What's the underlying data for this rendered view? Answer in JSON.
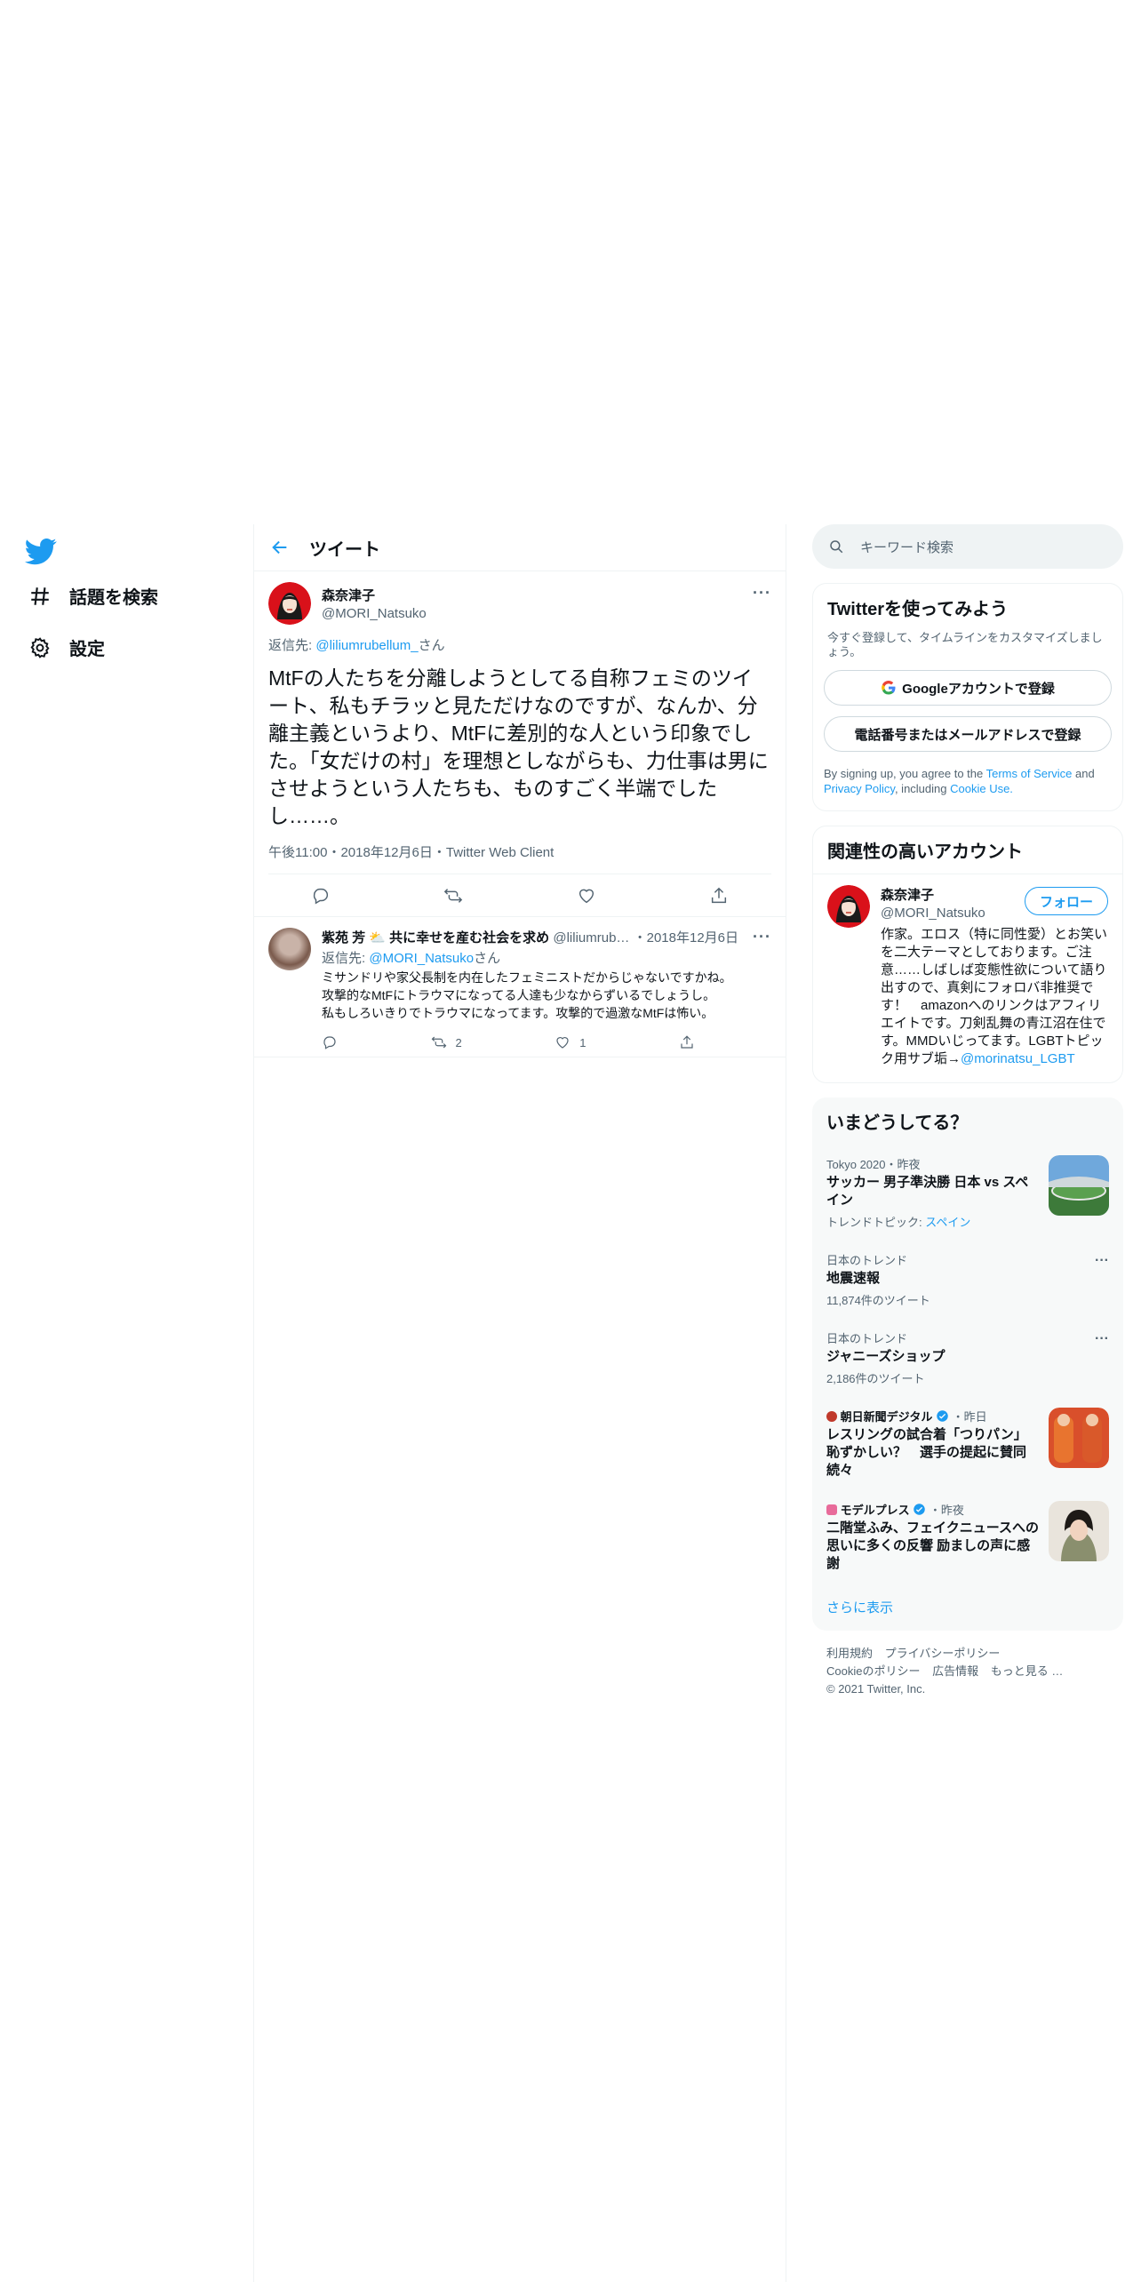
{
  "nav": {
    "explore_label": "話題を検索",
    "settings_label": "設定"
  },
  "header": {
    "title": "ツイート"
  },
  "tweet": {
    "author_name": "森奈津子",
    "author_handle": "@MORI_Natsuko",
    "replying_prefix": "返信先: ",
    "replying_handle": "@liliumrubellum_",
    "replying_suffix": "さん",
    "text": "MtFの人たちを分離しようとしてる自称フェミのツイート、私もチラッと見ただけなのですが、なんか、分離主義というより、MtFに差別的な人という印象でした。「女だけの村」を理想としながらも、力仕事は男にさせようという人たちも、ものすごく半端でしたし……。",
    "time": "午後11:00",
    "date": "2018年12月6日",
    "client": "Twitter Web Client"
  },
  "reply": {
    "name": "紫苑 芳 ⛅ 共に幸せを産む社会を求め",
    "handle": "@liliumrub…",
    "date": "2018年12月6日",
    "replying_prefix": "返信先: ",
    "replying_handle": "@MORI_Natsuko",
    "replying_suffix": "さん",
    "line1": "ミサンドリや家父長制を内在したフェミニストだからじゃないですかね。",
    "line2": "攻撃的なMtFにトラウマになってる人達も少なからずいるでしょうし。",
    "line3": "私もしろいきりでトラウマになってます。攻撃的で過激なMtFは怖い。",
    "retweets": "2",
    "likes": "1"
  },
  "search": {
    "placeholder": "キーワード検索"
  },
  "signup": {
    "title": "Twitterを使ってみよう",
    "desc": "今すぐ登録して、タイムラインをカスタマイズしましょう。",
    "google_btn": "Googleアカウントで登録",
    "phone_btn": "電話番号またはメールアドレスで登録",
    "legal_1": "By signing up, you agree to the ",
    "terms": "Terms of Service",
    "legal_2": " and ",
    "privacy": "Privacy Policy",
    "legal_3": ", including ",
    "cookie": "Cookie Use.",
    "legal_4": ""
  },
  "related": {
    "title": "関連性の高いアカウント",
    "name": "森奈津子",
    "handle": "@MORI_Natsuko",
    "follow": "フォロー",
    "bio": "作家。エロス（特に同性愛）とお笑いを二大テーマとしております。ご注意……しばしば変態性欲について語り出すので、真剣にフォロバ非推奨です！　amazonへのリンクはアフィリエイトです。刀剣乱舞の青江沼在住です。MMDいじってます。LGBTトピック用サブ垢→",
    "bio_link": "@morinatsu_LGBT"
  },
  "trends": {
    "title": "いまどうしてる？",
    "items": [
      {
        "meta": "Tokyo 2020・昨夜",
        "title": "サッカー 男子準決勝 日本 vs スペイン",
        "sub_label": "トレンドトピック: ",
        "sub_link": "スペイン"
      },
      {
        "meta": "日本のトレンド",
        "title": "地震速報",
        "sub": "11,874件のツイート"
      },
      {
        "meta": "日本のトレンド",
        "title": "ジャニーズショップ",
        "sub": "2,186件のツイート"
      },
      {
        "source": "朝日新聞デジタル",
        "time": "・昨日",
        "title": "レスリングの試合着「つりパン」恥ずかしい？　選手の提起に賛同続々"
      },
      {
        "source": "モデルプレス",
        "time": "・昨夜",
        "title": "二階堂ふみ、フェイクニュースへの思いに多くの反響 励ましの声に感謝"
      }
    ],
    "show_more": "さらに表示"
  },
  "footer": {
    "terms": "利用規約",
    "privacy": "プライバシーポリシー",
    "cookie": "Cookieのポリシー",
    "ads": "広告情報",
    "more": "もっと見る …",
    "copyright": "© 2021 Twitter, Inc."
  },
  "colors": {
    "accent": "#1d9bf0",
    "text": "#0f1419",
    "secondary": "#536471",
    "border": "#eff3f4"
  }
}
